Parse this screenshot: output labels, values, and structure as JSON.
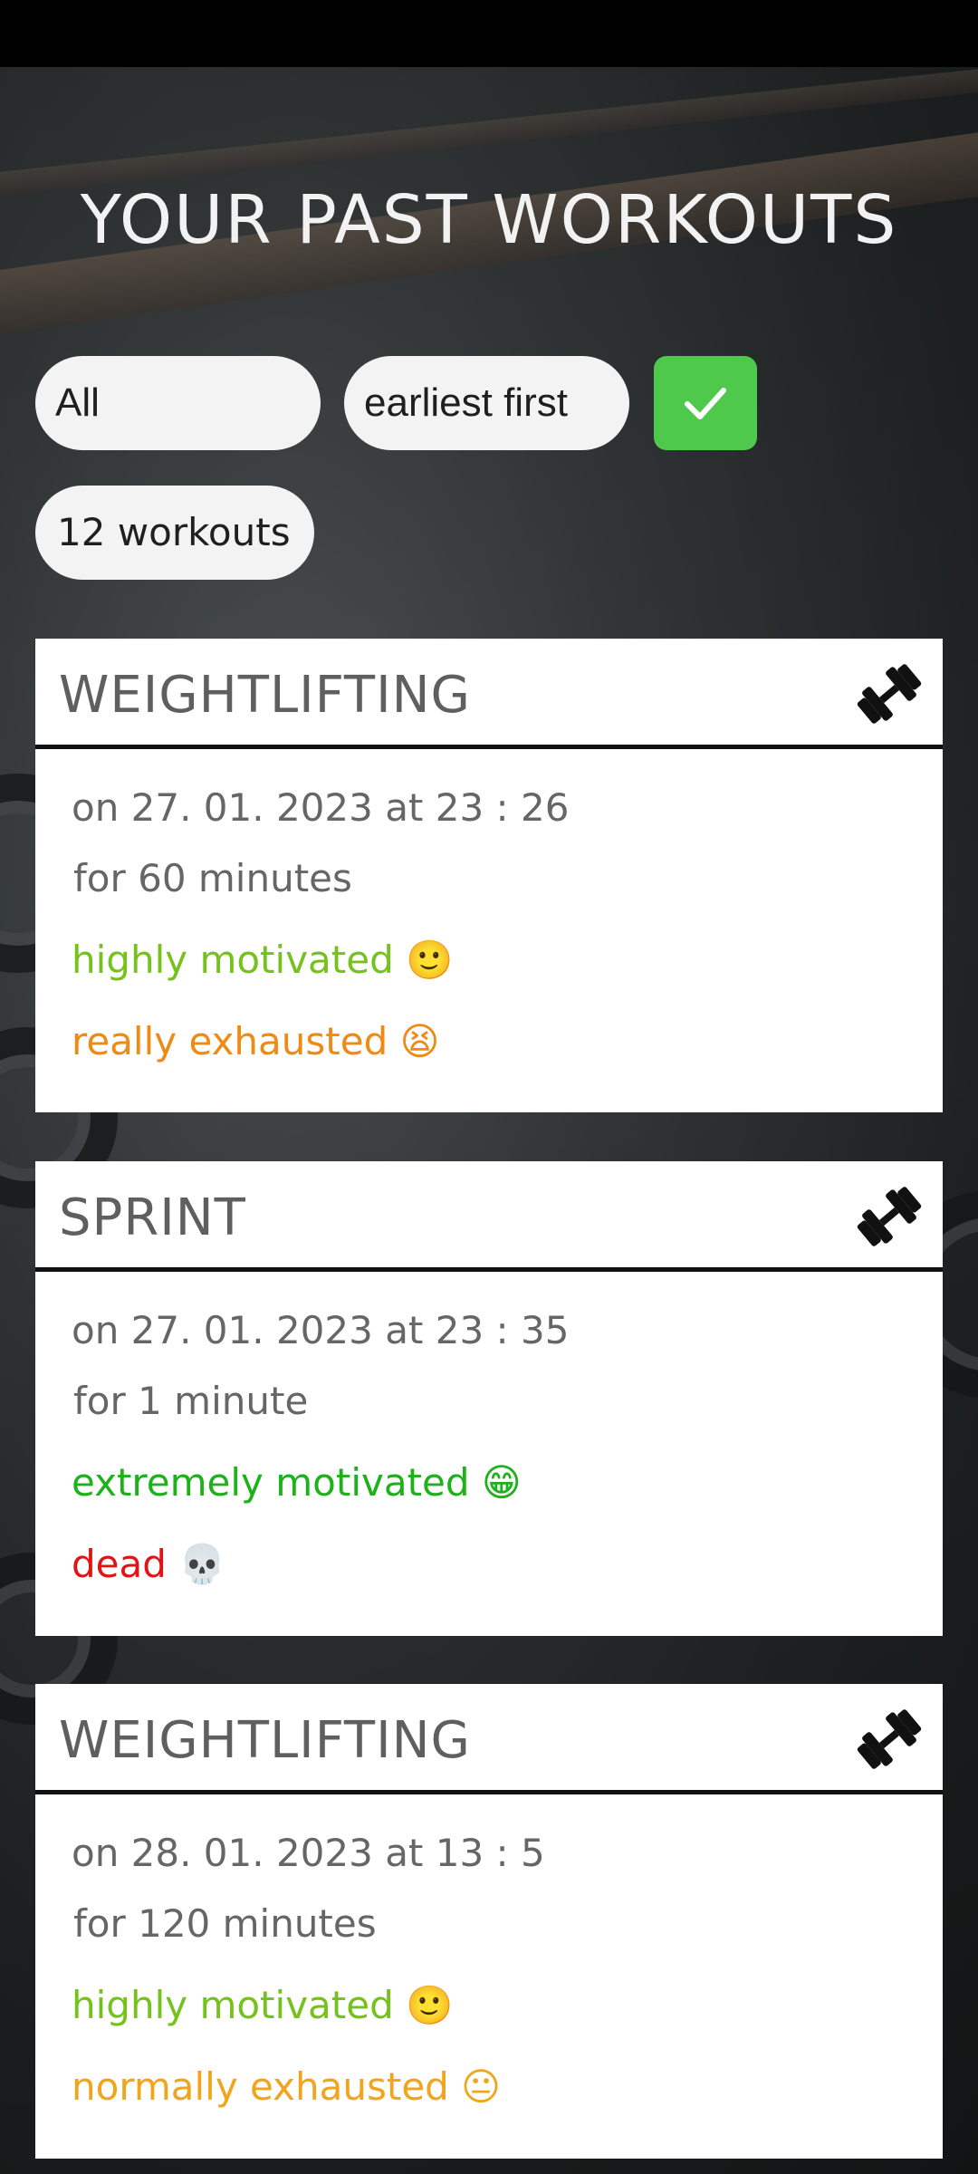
{
  "page": {
    "title": "YOUR PAST WORKOUTS"
  },
  "filters": {
    "type_value": "All",
    "sort_value": "earliest first",
    "count_label": "12 workouts"
  },
  "workouts": [
    {
      "title": "WEIGHTLIFTING",
      "icon": "dumbbell-icon",
      "date": "on 27. 01. 2023 at 23 : 26",
      "duration": "for 60 minutes",
      "motivation": "highly motivated 🙂",
      "exhaustion": "really exhausted 😫"
    },
    {
      "title": "SPRINT",
      "icon": "dumbbell-icon",
      "date": "on 27. 01. 2023 at 23 : 35",
      "duration": "for 1 minute",
      "motivation": "extremely motivated 😁",
      "exhaustion": "dead 💀"
    },
    {
      "title": "WEIGHTLIFTING",
      "icon": "dumbbell-icon",
      "date": "on 28. 01. 2023 at 13 : 5",
      "duration": "for 120 minutes",
      "motivation": "highly motivated 🙂",
      "exhaustion": "normally exhausted 😐"
    }
  ],
  "colors": {
    "confirm": "#4fc94b",
    "highly_motivated": "#76c21c",
    "extremely_motivated": "#1db11a",
    "really_exhausted": "#ef8a14",
    "dead": "#e01414",
    "normally_exhausted": "#f0a51c"
  }
}
